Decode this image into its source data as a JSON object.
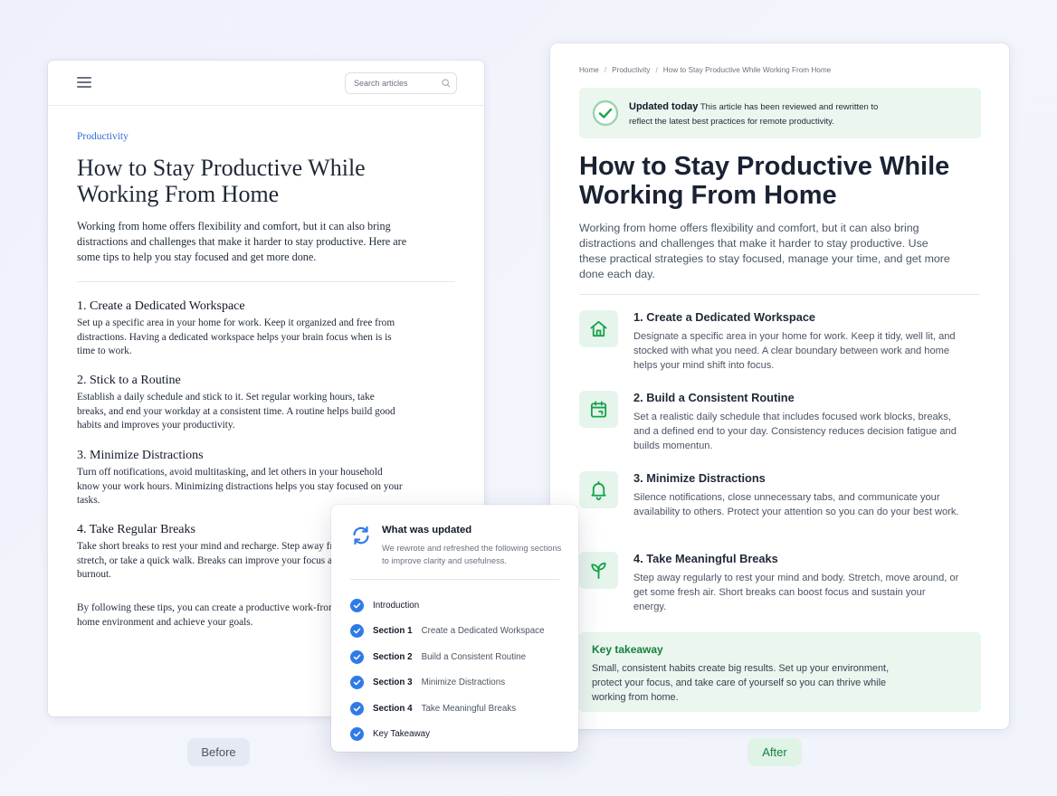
{
  "before": {
    "search_placeholder": "Search articles",
    "category": "Productivity",
    "title": "How to Stay Productive While Working From Home",
    "intro": "Working from home offers flexibility and comfort, but it can also bring distractions and challenges that make it harder to stay productive. Here are some tips to help you stay focused and get more done.",
    "sections": [
      {
        "title": "1. Create a Dedicated Workspace",
        "body": "Set up a specific area in your home for work. Keep it organized and free from distractions. Having a dedicated workspace helps your brain focus when is is time to work."
      },
      {
        "title": "2. Stick to a Routine",
        "body": "Establish a daily schedule and stick to it. Set regular working hours, take breaks, and end your workday at a consistent time. A routine helps build good habits and improves your productivity."
      },
      {
        "title": "3. Minimize Distractions",
        "body": "Turn off notifications, avoid multitasking, and let others in your household know your work hours. Minimizing distractions helps you stay focused on your tasks."
      },
      {
        "title": "4. Take Regular Breaks",
        "body": "Take short breaks to rest your mind and recharge. Step away from your desk, stretch, or take a quick walk. Breaks can improve your focus and prevent burnout."
      }
    ],
    "outro": "By following these tips, you can create a productive work-from-home environment and achieve your goals."
  },
  "after": {
    "breadcrumb": [
      "Home",
      "Productivity",
      "How to Stay Productive While Working From Home"
    ],
    "update": {
      "label": "Updated today",
      "text": "This article has been reviewed and rewritten to reflect the latest best practices for remote productivity."
    },
    "title": "How to Stay Productive While Working From Home",
    "intro": "Working from home offers flexibility and comfort, but it can also bring distractions and challenges that make it harder to stay productive. Use these practical strategies to stay focused, manage your time, and get more done each day.",
    "sections": [
      {
        "icon": "home-icon",
        "title": "1. Create a Dedicated Workspace",
        "body": "Designate a specific area in your home for work. Keep it tidy, well lit, and stocked with what you need. A clear boundary between work and home helps your mind shift into focus."
      },
      {
        "icon": "calendar-icon",
        "title": "2. Build a Consistent Routine",
        "body": "Set a realistic daily schedule that includes focused work blocks, breaks, and a defined end to your day. Consistency reduces decision fatigue and builds momentun."
      },
      {
        "icon": "bell-icon",
        "title": "3. Minimize Distractions",
        "body": "Silence notifications, close unnecessary tabs, and communicate your availability to others. Protect your attention so you can do your best work."
      },
      {
        "icon": "sprout-icon",
        "title": "4. Take Meaningful Breaks",
        "body": "Step away regularly to rest your mind and body. Stretch, move around, or get some fresh air. Short breaks can boost focus and sustain your energy."
      }
    ],
    "takeaway": {
      "title": "Key takeaway",
      "body": "Small, consistent habits create big results. Set up your environment, protect your focus, and take care of yourself so you can thrive while working from home."
    }
  },
  "popover": {
    "title": "What was updated",
    "subtitle": "We rewrote and refreshed the following sections to improve clarity and usefulness.",
    "items": [
      {
        "label": "Introduction",
        "detail": ""
      },
      {
        "label": "Section 1",
        "detail": "Create a Dedicated Workspace"
      },
      {
        "label": "Section 2",
        "detail": "Build a Consistent Routine"
      },
      {
        "label": "Section 3",
        "detail": "Minimize Distractions"
      },
      {
        "label": "Section 4",
        "detail": "Take Meaningful Breaks"
      },
      {
        "label": "Key Takeaway",
        "detail": ""
      }
    ]
  },
  "labels": {
    "before": "Before",
    "after": "After"
  },
  "colors": {
    "accent_green": "#15803d",
    "accent_blue": "#2f7be6",
    "link_blue": "#2f6bd8"
  }
}
